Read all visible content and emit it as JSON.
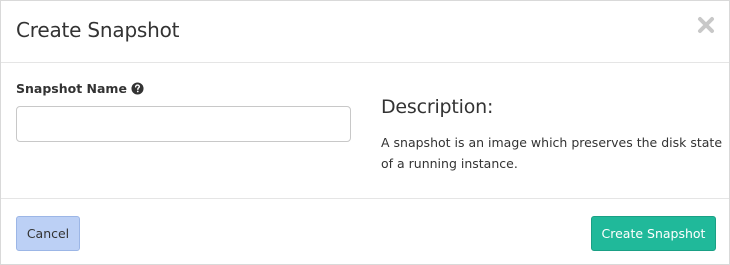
{
  "dialog": {
    "title": "Create Snapshot",
    "close_icon": "close-icon"
  },
  "form": {
    "snapshot_name_label": "Snapshot Name",
    "help_icon": "question-circle-icon",
    "snapshot_name_value": "",
    "snapshot_name_placeholder": ""
  },
  "description": {
    "heading": "Description:",
    "text": "A snapshot is an image which preserves the disk state of a running instance."
  },
  "footer": {
    "cancel_label": "Cancel",
    "submit_label": "Create Snapshot"
  },
  "colors": {
    "primary": "#20b99a",
    "cancel": "#bcd0f5",
    "close_icon": "#c8c8c8"
  }
}
